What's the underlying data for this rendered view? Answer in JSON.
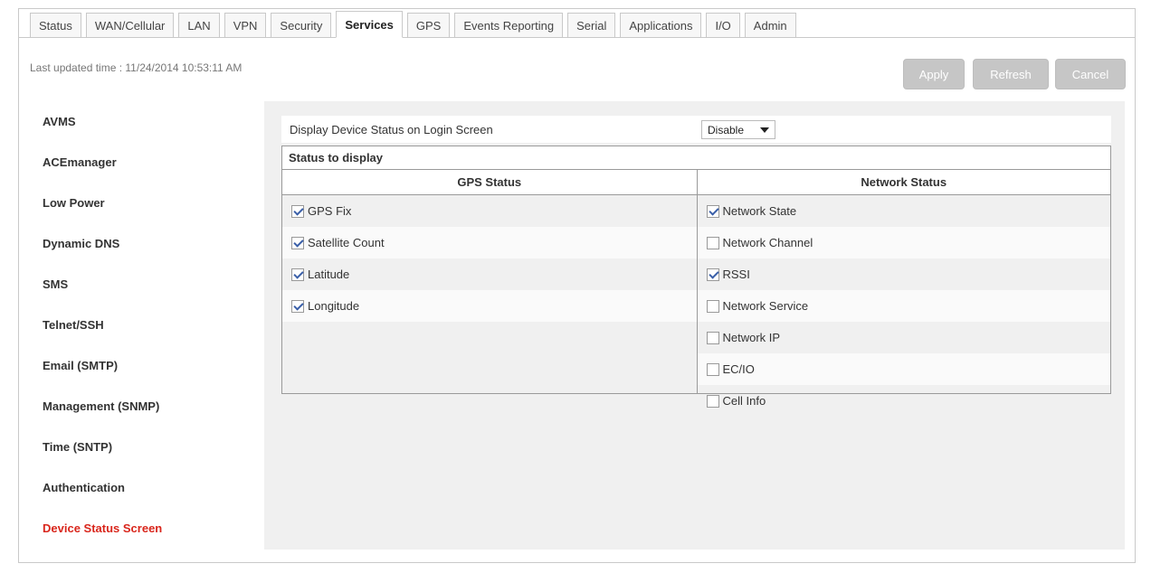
{
  "tabs": [
    {
      "label": "Status",
      "active": false
    },
    {
      "label": "WAN/Cellular",
      "active": false
    },
    {
      "label": "LAN",
      "active": false
    },
    {
      "label": "VPN",
      "active": false
    },
    {
      "label": "Security",
      "active": false
    },
    {
      "label": "Services",
      "active": true
    },
    {
      "label": "GPS",
      "active": false
    },
    {
      "label": "Events Reporting",
      "active": false
    },
    {
      "label": "Serial",
      "active": false
    },
    {
      "label": "Applications",
      "active": false
    },
    {
      "label": "I/O",
      "active": false
    },
    {
      "label": "Admin",
      "active": false
    }
  ],
  "last_updated": "Last updated time : 11/24/2014 10:53:11 AM",
  "buttons": {
    "apply": "Apply",
    "refresh": "Refresh",
    "cancel": "Cancel"
  },
  "sidebar": [
    {
      "label": "AVMS",
      "active": false
    },
    {
      "label": "ACEmanager",
      "active": false
    },
    {
      "label": "Low Power",
      "active": false
    },
    {
      "label": "Dynamic DNS",
      "active": false
    },
    {
      "label": "SMS",
      "active": false
    },
    {
      "label": "Telnet/SSH",
      "active": false
    },
    {
      "label": "Email (SMTP)",
      "active": false
    },
    {
      "label": "Management (SNMP)",
      "active": false
    },
    {
      "label": "Time (SNTP)",
      "active": false
    },
    {
      "label": "Authentication",
      "active": false
    },
    {
      "label": "Device Status Screen",
      "active": true
    }
  ],
  "display_setting": {
    "label": "Display Device Status on Login Screen",
    "value": "Disable"
  },
  "status_table": {
    "title": "Status to display",
    "gps": {
      "header": "GPS Status",
      "items": [
        {
          "label": "GPS Fix",
          "checked": true
        },
        {
          "label": "Satellite Count",
          "checked": true
        },
        {
          "label": "Latitude",
          "checked": true
        },
        {
          "label": "Longitude",
          "checked": true
        }
      ]
    },
    "network": {
      "header": "Network Status",
      "items": [
        {
          "label": "Network State",
          "checked": true
        },
        {
          "label": "Network Channel",
          "checked": false
        },
        {
          "label": "RSSI",
          "checked": true
        },
        {
          "label": "Network Service",
          "checked": false
        },
        {
          "label": "Network IP",
          "checked": false
        },
        {
          "label": "EC/IO",
          "checked": false
        },
        {
          "label": "Cell Info",
          "checked": false
        }
      ]
    }
  },
  "colors": {
    "active_sidebar": "#d9261c",
    "button_disabled": "#c6c6c6",
    "content_bg": "#f0f0f0"
  }
}
